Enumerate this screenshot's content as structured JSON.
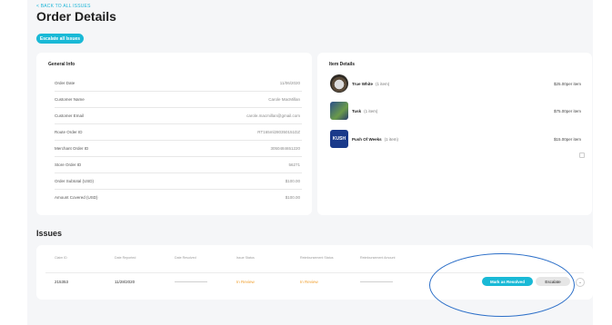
{
  "header": {
    "back_link": "< BACK TO ALL ISSUES",
    "title": "Order Details",
    "escalate_all_label": "Escalate all Issues"
  },
  "general_info": {
    "title": "General Info",
    "rows": [
      {
        "label": "Order Date",
        "value": "11/06/2020"
      },
      {
        "label": "Customer Name",
        "value": "Carole MacMillan"
      },
      {
        "label": "Customer Email",
        "value": "carole.macmillan@gmail.com"
      },
      {
        "label": "Route Order ID",
        "value": "RT165ml280350151DZ"
      },
      {
        "label": "Merchant Order ID",
        "value": "3050484651220"
      },
      {
        "label": "Store Order ID",
        "value": "56271"
      },
      {
        "label": "Order Subtotal (USD)",
        "value": "$100.00"
      },
      {
        "label": "Amount Covered (USD)",
        "value": "$100.00"
      }
    ]
  },
  "item_details": {
    "title": "Item Details",
    "items": [
      {
        "name": "True White",
        "qty": "(1 item)",
        "price": "$25.00per item",
        "thumb_icon": "vinyl-record-icon"
      },
      {
        "name": "Tusk",
        "qty": "(1 item)",
        "price": "$75.00per item",
        "thumb_icon": "album-cover-icon"
      },
      {
        "name": "Push Of Weeks",
        "qty": "(1 item)",
        "price": "$15.00per item",
        "thumb_icon": "album-cover-icon",
        "thumb_text": "KUSH"
      }
    ]
  },
  "issues": {
    "title": "Issues",
    "columns": [
      "Claim ID",
      "Date Reported",
      "Date Resolved",
      "Issue Status",
      "Reimbursement Status",
      "Reimbursement Amount"
    ],
    "rows": [
      {
        "claim_id": "215353",
        "date_reported": "11/28/2020",
        "issue_status": "In Review",
        "reimbursement_status": "In Review",
        "resolve_label": "Mark as Resolved",
        "escalate_label": "Escalate",
        "more_icon": "chevron-down-icon"
      }
    ]
  },
  "colors": {
    "accent": "#19b9d6",
    "pending": "#f0a030",
    "annotation": "#2c6fc8"
  }
}
